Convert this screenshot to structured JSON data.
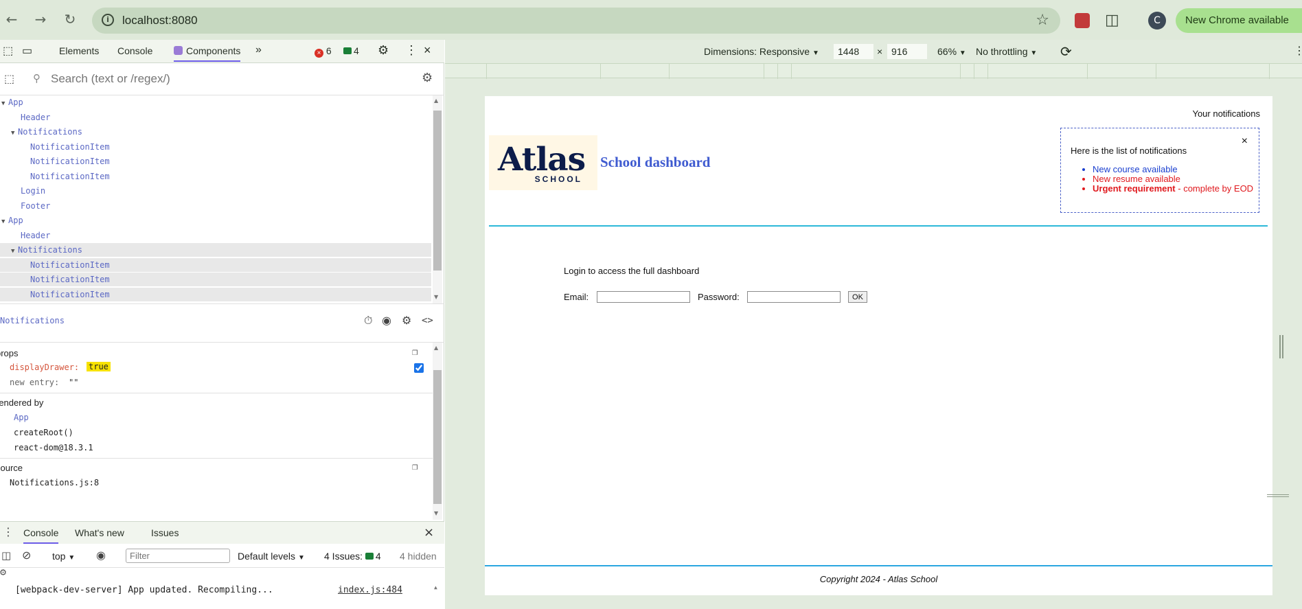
{
  "browser": {
    "url": "localhost:8080",
    "new_chrome_label": "New Chrome available",
    "avatar_letter": "C"
  },
  "devtools": {
    "tabs": [
      "Elements",
      "Console",
      "Components"
    ],
    "error_count": "6",
    "message_count": "4",
    "search_placeholder": "Search (text or /regex/)",
    "tree": [
      {
        "label": "App",
        "indent": 0,
        "expanded": true
      },
      {
        "label": "Header",
        "indent": 2
      },
      {
        "label": "Notifications",
        "indent": 1,
        "expanded": true
      },
      {
        "label": "NotificationItem",
        "indent": 3
      },
      {
        "label": "NotificationItem",
        "indent": 3
      },
      {
        "label": "NotificationItem",
        "indent": 3
      },
      {
        "label": "Login",
        "indent": 2
      },
      {
        "label": "Footer",
        "indent": 2
      },
      {
        "label": "App",
        "indent": 0,
        "expanded": true
      },
      {
        "label": "Header",
        "indent": 2
      },
      {
        "label": "Notifications",
        "indent": 1,
        "expanded": true,
        "selected": true
      },
      {
        "label": "NotificationItem",
        "indent": 3,
        "selected": true
      },
      {
        "label": "NotificationItem",
        "indent": 3,
        "selected": true
      },
      {
        "label": "NotificationItem",
        "indent": 3,
        "selected": true
      }
    ],
    "inspector": {
      "component_name": "Notifications",
      "props_label": "props",
      "prop_key": "displayDrawer",
      "prop_value": "true",
      "new_entry_label": "new entry",
      "new_entry_value": "\"\"",
      "rendered_by_label": "rendered by",
      "rendered_by": [
        "App",
        "createRoot()",
        "react-dom@18.3.1"
      ],
      "source_label": "source",
      "source_value": "Notifications.js:8"
    },
    "drawer_tabs": [
      "Console",
      "What's new",
      "Issues"
    ],
    "console": {
      "context": "top",
      "filter_placeholder": "Filter",
      "levels": "Default levels",
      "issues": "4 Issues:",
      "issues_count": "4",
      "hidden": "4 hidden",
      "log_message": "[webpack-dev-server] App updated. Recompiling...",
      "log_source": "index.js:484"
    }
  },
  "device": {
    "dimensions_label": "Dimensions: Responsive",
    "width": "1448",
    "times": "×",
    "height": "916",
    "zoom": "66%",
    "throttling": "No throttling"
  },
  "page": {
    "notifications_title": "Your notifications",
    "close_glyph": "×",
    "notifications_heading": "Here is the list of notifications",
    "notifications": [
      {
        "text": "New course available",
        "type": "default"
      },
      {
        "text": "New resume available",
        "type": "urgent"
      },
      {
        "html_strong": "Urgent requirement",
        "rest": " - complete by EOD",
        "type": "urgent"
      }
    ],
    "logo_word": "Atlas",
    "logo_sub": "SCHOOL",
    "title": "School dashboard",
    "login_message": "Login to access the full dashboard",
    "email_label": "Email:",
    "password_label": "Password:",
    "ok_label": "OK",
    "footer": "Copyright 2024 - Atlas School"
  },
  "colors": {
    "accent_purple": "#6c5ce7",
    "title_blue": "#3f5bd0",
    "urgent_red": "#e0191e",
    "default_blue": "#1a3fcf",
    "header_line": "#2cb8d8"
  }
}
